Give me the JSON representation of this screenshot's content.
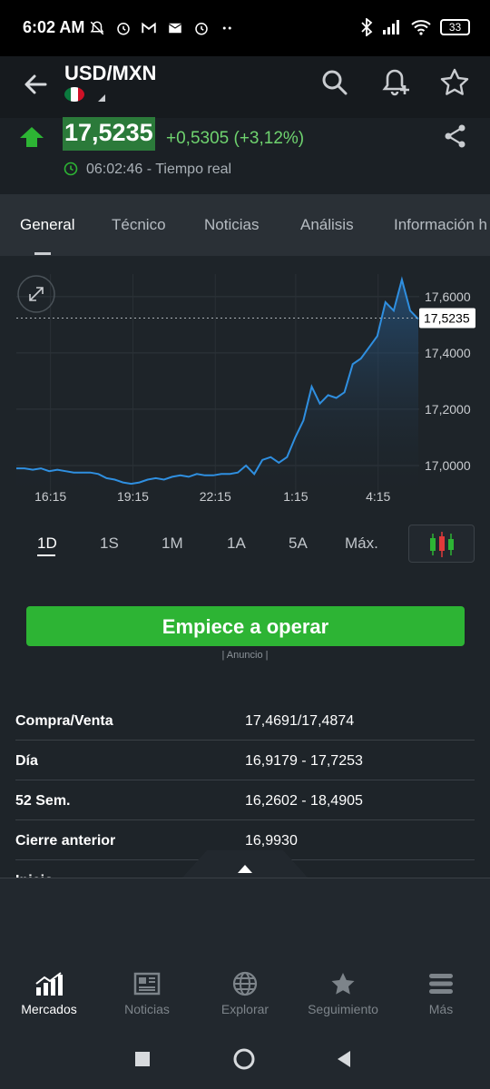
{
  "status_bar": {
    "time": "6:02 AM",
    "left_icons": [
      "mute-icon",
      "alarm-icon",
      "gmail-icon",
      "mail-icon",
      "alarm-icon",
      "more-dots-icon"
    ],
    "right_icons": [
      "bluetooth-icon",
      "signal-icon",
      "wifi-icon"
    ],
    "battery": "33"
  },
  "header": {
    "pair": "USD/MXN",
    "flag": "mexico-flag-icon",
    "actions": [
      "search-icon",
      "add-alert-icon",
      "star-icon"
    ]
  },
  "quote": {
    "price": "17,5235",
    "change": "+0,5305 (+3,12%)",
    "time": "06:02:46",
    "time_suffix": "- Tiempo real",
    "up_color": "#2db434",
    "price_bg": "#2b7a3a"
  },
  "tabs": [
    {
      "label": "General",
      "active": true
    },
    {
      "label": "Técnico"
    },
    {
      "label": "Noticias"
    },
    {
      "label": "Análisis"
    },
    {
      "label": "Información h"
    }
  ],
  "chart_data": {
    "type": "area",
    "x_ticks": [
      "16:15",
      "19:15",
      "22:15",
      "1:15",
      "4:15"
    ],
    "y_ticks": [
      "17,6000",
      "17,4000",
      "17,2000",
      "17,0000"
    ],
    "current_label": "17,5235",
    "ylim": [
      16.9,
      17.68
    ],
    "y": [
      16.99,
      16.99,
      16.985,
      16.99,
      16.98,
      16.985,
      16.98,
      16.975,
      16.975,
      16.975,
      16.97,
      16.955,
      16.95,
      16.94,
      16.935,
      16.94,
      16.95,
      16.955,
      16.95,
      16.96,
      16.965,
      16.96,
      16.97,
      16.965,
      16.965,
      16.97,
      16.97,
      16.975,
      17.0,
      16.97,
      17.02,
      17.03,
      17.01,
      17.03,
      17.1,
      17.16,
      17.28,
      17.22,
      17.25,
      17.24,
      17.26,
      17.36,
      17.38,
      17.42,
      17.46,
      17.58,
      17.55,
      17.66,
      17.55,
      17.52
    ]
  },
  "ranges": [
    {
      "label": "1D",
      "active": true
    },
    {
      "label": "1S"
    },
    {
      "label": "1M"
    },
    {
      "label": "1A"
    },
    {
      "label": "5A"
    },
    {
      "label": "Máx."
    }
  ],
  "cta": {
    "label": "Empiece a operar",
    "ad": "| Anuncio |"
  },
  "stats": [
    {
      "key": "Compra/Venta",
      "value": "17,4691/17,4874"
    },
    {
      "key": "Día",
      "value": "16,9179 - 17,7253"
    },
    {
      "key": "52 Sem.",
      "value": "16,2602 - 18,4905"
    },
    {
      "key": "Cierre anterior",
      "value": "16,9930"
    },
    {
      "key": "Inicio",
      "value": ""
    }
  ],
  "bottom_nav": [
    {
      "label": "Mercados",
      "icon": "markets-chart-icon",
      "active": true
    },
    {
      "label": "Noticias",
      "icon": "newspaper-icon"
    },
    {
      "label": "Explorar",
      "icon": "globe-icon"
    },
    {
      "label": "Seguimiento",
      "icon": "star-icon"
    },
    {
      "label": "Más",
      "icon": "menu-icon"
    }
  ],
  "system_nav": [
    "recents-button",
    "home-button",
    "back-button"
  ]
}
